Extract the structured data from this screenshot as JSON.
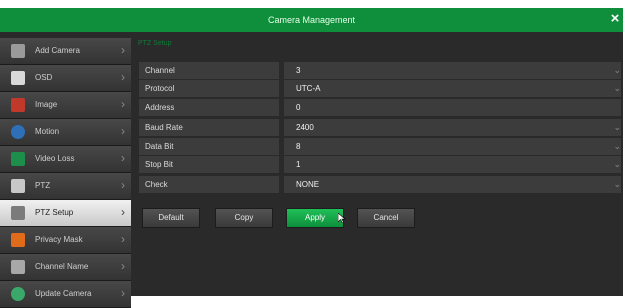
{
  "window": {
    "title": "Camera Management",
    "close_glyph": "×"
  },
  "sidebar": {
    "items": [
      {
        "label": "Add Camera",
        "icon": "add-camera-icon",
        "color": "#9a9a9a"
      },
      {
        "label": "OSD",
        "icon": "osd-icon",
        "color": "#d9d9d9"
      },
      {
        "label": "Image",
        "icon": "image-icon",
        "color": "#c0392b"
      },
      {
        "label": "Motion",
        "icon": "motion-icon",
        "color": "#2e6fb7"
      },
      {
        "label": "Video Loss",
        "icon": "video-loss-icon",
        "color": "#1e8f4a"
      },
      {
        "label": "PTZ",
        "icon": "ptz-camera-icon",
        "color": "#c8c8c8"
      },
      {
        "label": "PTZ Setup",
        "icon": "ptz-setup-icon",
        "color": "#7b7b7b"
      },
      {
        "label": "Privacy Mask",
        "icon": "privacy-mask-icon",
        "color": "#e06b1a"
      },
      {
        "label": "Channel Name",
        "icon": "channel-name-icon",
        "color": "#a8a8a8"
      },
      {
        "label": "Update Camera",
        "icon": "update-camera-icon",
        "color": "#3aa86b"
      }
    ],
    "active": "PTZ Setup"
  },
  "section_title": "PTZ Setup",
  "fields": [
    {
      "label": "Channel",
      "value": "3"
    },
    {
      "label": "Protocol",
      "value": "UTC-A"
    },
    {
      "label": "Address",
      "value": "0"
    },
    {
      "label": "Baud Rate",
      "value": "2400"
    },
    {
      "label": "Data Bit",
      "value": "8"
    },
    {
      "label": "Stop Bit",
      "value": "1"
    },
    {
      "label": "Check",
      "value": "NONE"
    }
  ],
  "buttons": {
    "default": "Default",
    "copy": "Copy",
    "apply": "Apply",
    "cancel": "Cancel"
  },
  "colors": {
    "accent": "#0f8f3c",
    "title_green": "#127a37"
  }
}
